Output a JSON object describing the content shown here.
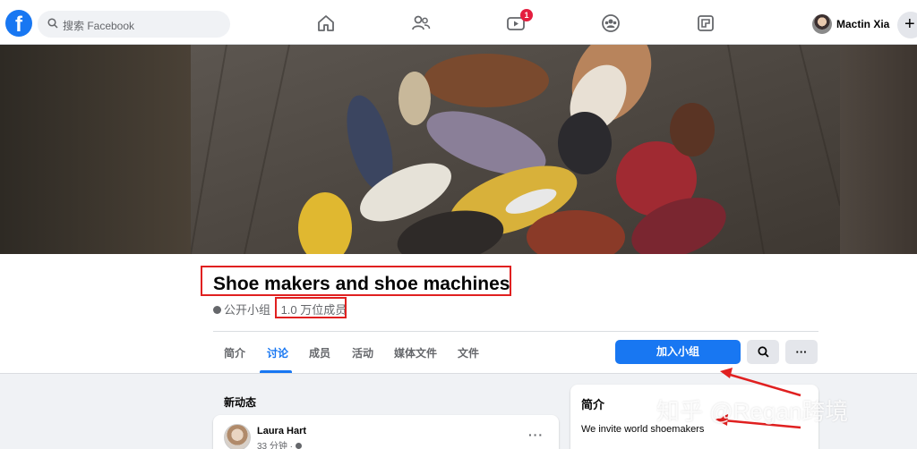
{
  "topbar": {
    "search_placeholder": "搜索 Facebook",
    "notification_count": "1",
    "profile_name": "Mactin Xia",
    "plus_symbol": "+",
    "logo_letter": "f"
  },
  "group": {
    "name": "Shoe makers and shoe machines",
    "privacy": "公开小组",
    "members": "1.0 万位成员",
    "join_label": "加入小组",
    "more_label": "···"
  },
  "tabs": [
    {
      "label": "简介"
    },
    {
      "label": "讨论"
    },
    {
      "label": "成员"
    },
    {
      "label": "活动"
    },
    {
      "label": "媒体文件"
    },
    {
      "label": "文件"
    }
  ],
  "feed": {
    "heading": "新动态",
    "post": {
      "author": "Laura Hart",
      "time": "33 分钟 · ",
      "more": "···"
    }
  },
  "about": {
    "heading": "简介",
    "text": "We invite world shoemakers"
  },
  "watermark": "知乎 @Regan跨境",
  "colors": {
    "brand": "#1877f2",
    "annotation": "#e02020",
    "badge": "#e41e3f"
  },
  "icons": [
    "facebook-logo-icon",
    "search-icon",
    "home-icon",
    "friends-icon",
    "watch-icon",
    "groups-icon",
    "gaming-icon",
    "avatar",
    "plus-icon",
    "globe-icon",
    "magnifier-icon",
    "more-icon"
  ]
}
